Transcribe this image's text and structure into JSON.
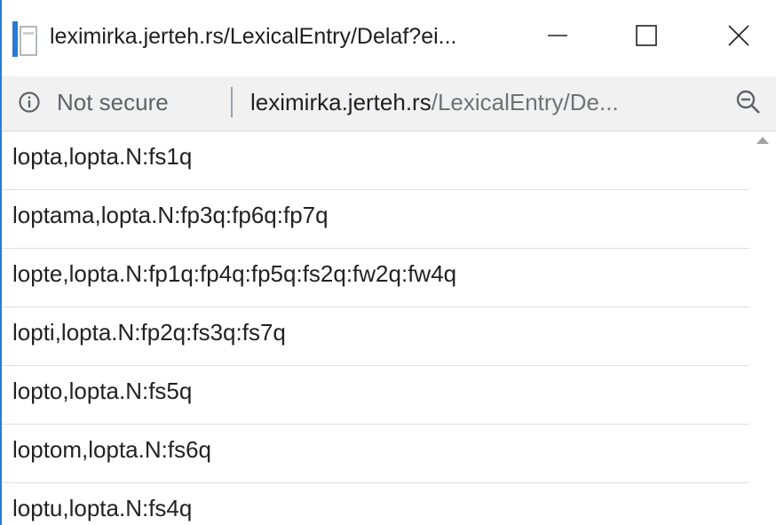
{
  "window": {
    "title": "leximirka.jerteh.rs/LexicalEntry/Delaf?ei..."
  },
  "addressbar": {
    "security_label": "Not secure",
    "url_host": "leximirka.jerteh.rs",
    "url_path": "/LexicalEntry/De..."
  },
  "entries": [
    "lopta,lopta.N:fs1q",
    "loptama,lopta.N:fp3q:fp6q:fp7q",
    "lopte,lopta.N:fp1q:fp4q:fp5q:fs2q:fw2q:fw4q",
    "lopti,lopta.N:fp2q:fs3q:fs7q",
    "lopto,lopta.N:fs5q",
    "loptom,lopta.N:fs6q",
    "loptu,lopta.N:fs4q"
  ],
  "icons": {
    "app": "page-icon",
    "minimize": "minimize-icon",
    "maximize": "maximize-icon",
    "close": "close-icon",
    "info": "info-icon",
    "zoom": "zoom-out-icon"
  },
  "colors": {
    "window_border": "#2b79d6",
    "addressbar_bg": "#f1f1f1",
    "url_host": "#202124",
    "url_path": "#6f7275"
  }
}
